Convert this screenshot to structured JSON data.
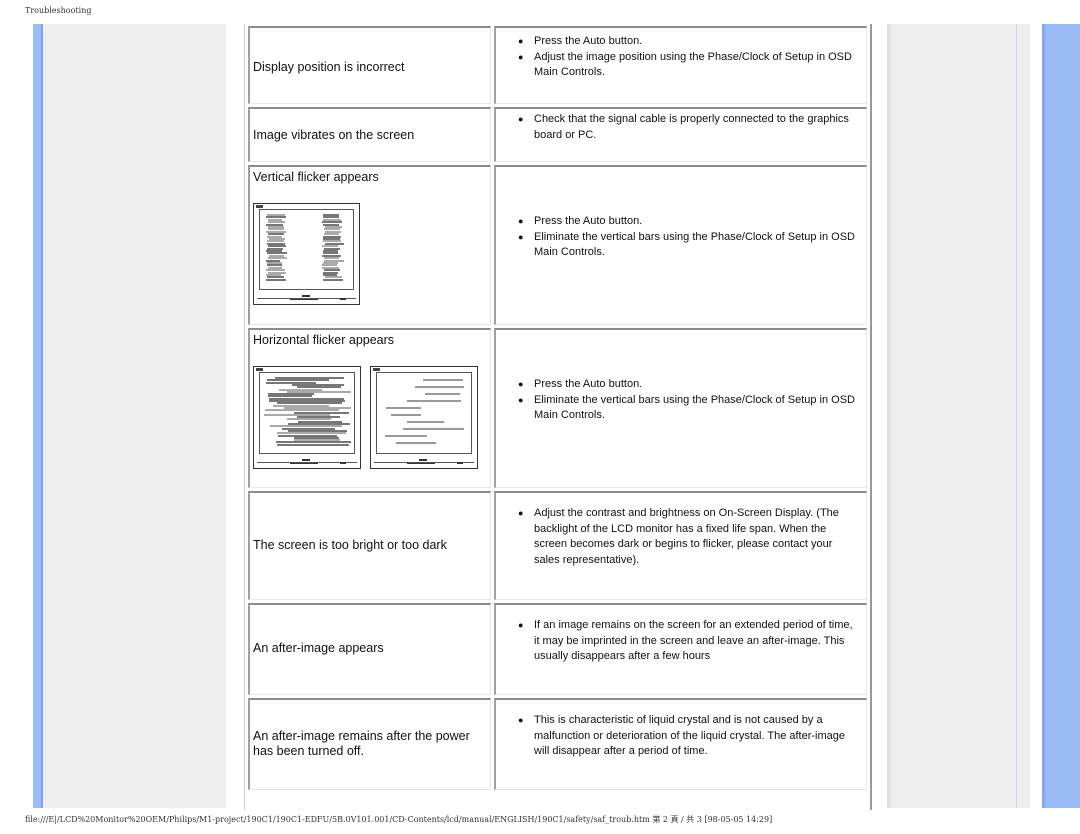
{
  "header": {
    "title": "Troubleshooting"
  },
  "footer": {
    "path": "file:///E|/LCD%20Monitor%20OEM/Philips/M1-project/190C1/190C1-EDFU/5B.0V101.001/CD-Contents/lcd/manual/ENGLISH/190C1/safety/saf_troub.htm 第 2 頁 / 共 3 [98-05-05 14:29]"
  },
  "colors": {
    "accent_bar": "#9bbcf7",
    "side_panel": "#eeeeee"
  },
  "rows": [
    {
      "problem": "Display position is incorrect",
      "solutions": [
        "Press the Auto button.",
        "Adjust the image position using the Phase/Clock of Setup in OSD Main Controls."
      ]
    },
    {
      "problem": "Image vibrates on the screen",
      "solutions": [
        "Check that the signal cable is properly connected to the graphics board or PC."
      ]
    },
    {
      "problem": "Vertical flicker appears",
      "image": "vertical-flicker-illustration",
      "solutions": [
        "Press the Auto button.",
        "Eliminate the vertical bars using the Phase/Clock of Setup in OSD Main Controls."
      ]
    },
    {
      "problem": "Horizontal flicker appears",
      "image": "horizontal-flicker-illustration",
      "solutions": [
        "Press the Auto button.",
        "Eliminate the vertical bars using the Phase/Clock of Setup in OSD Main Controls."
      ]
    },
    {
      "problem": "The screen is too bright or too dark",
      "solutions": [
        "Adjust the contrast and brightness on On-Screen Display. (The backlight of the LCD monitor has a fixed life span. When the screen becomes dark or begins to flicker, please contact your sales representative)."
      ]
    },
    {
      "problem": "An after-image appears",
      "solutions": [
        "If an image remains on the screen for an extended period of time, it may be imprinted in the screen and leave an after-image. This usually disappears after a few hours"
      ]
    },
    {
      "problem": "An after-image remains after the power has been turned off.",
      "solutions": [
        "This is characteristic of liquid crystal and is not caused by a malfunction or deterioration of the liquid crystal. The after-image will disappear after a period of time."
      ]
    }
  ]
}
